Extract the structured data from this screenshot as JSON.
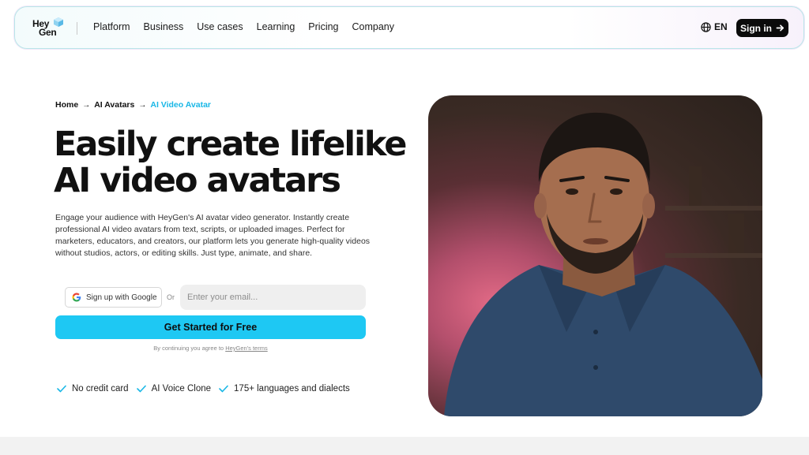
{
  "nav": {
    "logo_line1": "Hey",
    "logo_line2": "Gen",
    "menu": [
      "Platform",
      "Business",
      "Use cases",
      "Learning",
      "Pricing",
      "Company"
    ],
    "language": "EN",
    "signin_label": "Sign in"
  },
  "breadcrumb": [
    "Home",
    "AI Avatars",
    "AI Video Avatar"
  ],
  "hero": {
    "title_line1": "Easily create lifelike",
    "title_line2": "AI video avatars",
    "description": "Engage your audience with HeyGen's AI avatar video generator. Instantly create professional AI video avatars from text, scripts, or uploaded images. Perfect for marketers, educators, and creators, our platform lets you generate high-quality videos without studios, actors, or editing skills. Just type, animate, and share."
  },
  "signup": {
    "google_label": "Sign up with Google",
    "or_label": "Or",
    "email_placeholder": "Enter your email...",
    "cta_label": "Get Started for Free",
    "terms_prefix": "By continuing you agree to",
    "terms_link": "HeyGen's terms"
  },
  "features": [
    "No credit card",
    "AI Voice Clone",
    "175+ languages and dialects"
  ],
  "colors": {
    "accent": "#1ec8f3",
    "breadcrumb_active": "#19b7e6",
    "feature_check": "#19b7e6"
  }
}
